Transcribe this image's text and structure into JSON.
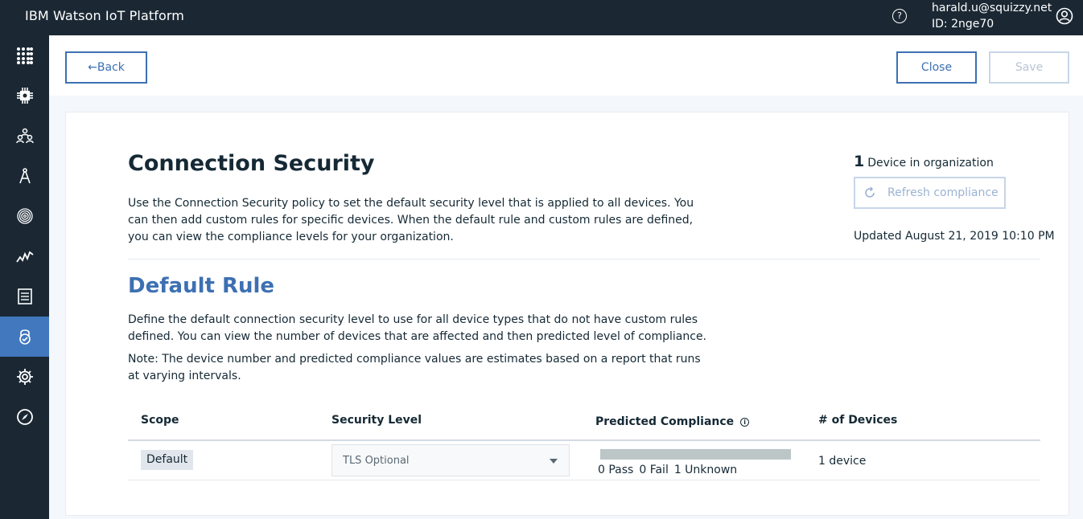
{
  "header": {
    "title": "IBM Watson IoT Platform",
    "help_glyph": "?",
    "user_email": "harald.u@squizzy.net",
    "org_id": "ID: 2nge70"
  },
  "sidebar": {
    "items": [
      {
        "icon": "apps-grid-icon"
      },
      {
        "icon": "chip-icon"
      },
      {
        "icon": "members-icon"
      },
      {
        "icon": "compass-draw-icon"
      },
      {
        "icon": "fingerprint-icon"
      },
      {
        "icon": "usage-chart-icon"
      },
      {
        "icon": "logs-icon"
      },
      {
        "icon": "security-lock-icon",
        "active": true
      },
      {
        "icon": "settings-gear-icon"
      },
      {
        "icon": "explore-compass-icon"
      }
    ]
  },
  "toolbar": {
    "back_label": "←Back",
    "close_label": "Close",
    "save_label": "Save"
  },
  "page": {
    "title": "Connection Security",
    "intro": "Use the Connection Security policy to set the default security level that is applied to all devices. You can then add custom rules for specific devices. When the default rule and custom rules are defined, you can view the compliance levels for your organization.",
    "device_count": "1",
    "device_count_label": "Device in organization",
    "refresh_label": "Refresh compliance",
    "updated": "Updated August 21, 2019 10:10 PM"
  },
  "default_rule": {
    "title": "Default Rule",
    "description": "Define the default connection security level to use for all device types that do not have custom rules defined. You can view the number of devices that are affected and then predicted level of compliance.",
    "note": "Note: The device number and predicted compliance values are estimates based on a report that runs at varying intervals."
  },
  "table": {
    "headers": {
      "scope": "Scope",
      "security_level": "Security Level",
      "predicted_compliance": "Predicted Compliance",
      "devices": "# of Devices"
    },
    "row": {
      "scope": "Default",
      "security_level": "TLS Optional",
      "pass": "0 Pass",
      "fail": "0 Fail",
      "unknown": "1 Unknown",
      "devices": "1 device"
    }
  },
  "colors": {
    "topbar": "#1b2834",
    "accent": "#3d70b2",
    "active_nav": "#4178be"
  }
}
